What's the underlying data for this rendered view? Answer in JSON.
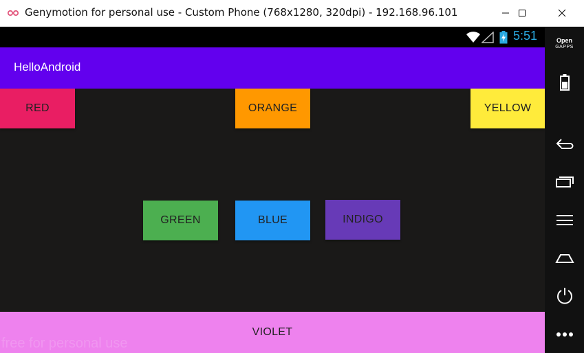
{
  "window": {
    "title": "Genymotion for personal use - Custom Phone (768x1280, 320dpi) - 192.168.96.101",
    "app_icon": "genymotion-logo-icon",
    "controls": [
      "minimize-icon",
      "maximize-icon",
      "close-icon"
    ]
  },
  "status_bar": {
    "time": "5:51",
    "icons": [
      "wifi-icon",
      "signal-icon",
      "battery-charging-icon"
    ],
    "time_color": "#2aa9e0"
  },
  "app_bar": {
    "title": "HelloAndroid",
    "color": "#6200ee"
  },
  "buttons": {
    "red": {
      "label": "RED",
      "color": "#e91e63"
    },
    "orange": {
      "label": "ORANGE",
      "color": "#ff9800"
    },
    "yellow": {
      "label": "YELLOW",
      "color": "#ffeb3b"
    },
    "green": {
      "label": "GREEN",
      "color": "#4caf50"
    },
    "blue": {
      "label": "BLUE",
      "color": "#2196f3"
    },
    "indigo": {
      "label": "INDIGO",
      "color": "#673ab7"
    },
    "violet": {
      "label": "VIOLET",
      "color": "#ee82ee"
    }
  },
  "watermark": "free for personal use",
  "side_panel": {
    "brand_line1": "Open",
    "brand_line2": "GAPPS",
    "icons": [
      "battery-icon",
      "back-icon",
      "recent-apps-icon",
      "menu-icon",
      "home-icon",
      "power-icon",
      "more-options-icon"
    ]
  }
}
